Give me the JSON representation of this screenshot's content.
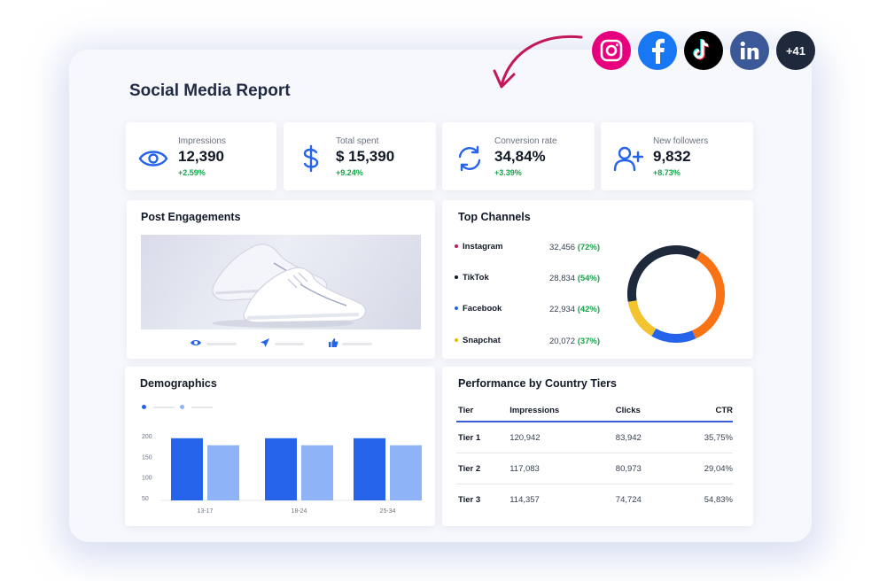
{
  "report": {
    "title": "Social Media Report"
  },
  "social_icons": [
    {
      "name": "instagram-icon",
      "color": "#e1306c"
    },
    {
      "name": "facebook-icon",
      "color": "#1877f2"
    },
    {
      "name": "tiktok-icon",
      "color": "#000000"
    },
    {
      "name": "linkedin-icon",
      "color": "#3b5998"
    }
  ],
  "more_badge": "+41",
  "kpis": [
    {
      "label": "Impressions",
      "value": "12,390",
      "delta": "+2.59%",
      "icon": "eye-icon"
    },
    {
      "label": "Total spent",
      "value": "$ 15,390",
      "delta": "+9.24%",
      "icon": "dollar-icon"
    },
    {
      "label": "Conversion rate",
      "value": "34,84%",
      "delta": "+3.39%",
      "icon": "refresh-icon"
    },
    {
      "label": "New followers",
      "value": "9,832",
      "delta": "+8.73%",
      "icon": "add-user-icon"
    }
  ],
  "post_engagements": {
    "title": "Post Engagements"
  },
  "top_channels": {
    "title": "Top Channels",
    "items": [
      {
        "name": "Instagram",
        "value": "32,456",
        "pct": "(72%)",
        "color": "#e1306c"
      },
      {
        "name": "TikTok",
        "value": "28,834",
        "pct": "(54%)",
        "color": "#111827"
      },
      {
        "name": "Facebook",
        "value": "22,934",
        "pct": "(42%)",
        "color": "#2563eb"
      },
      {
        "name": "Snapchat",
        "value": "20,072",
        "pct": "(37%)",
        "color": "#f4b400"
      }
    ]
  },
  "demographics": {
    "title": "Demographics",
    "chart_data": {
      "type": "bar",
      "categories": [
        "13-17",
        "18-24",
        "25-34"
      ],
      "series": [
        {
          "values": [
            194,
            194,
            194
          ],
          "color": "#2563eb"
        },
        {
          "values": [
            177,
            177,
            177
          ],
          "color": "#8fb3f7"
        }
      ],
      "ylim": [
        50,
        200
      ],
      "yticks": [
        200,
        150,
        100,
        50
      ]
    }
  },
  "country_tiers": {
    "title": "Performance by Country Tiers",
    "columns": [
      "Tier",
      "Impressions",
      "Clicks",
      "CTR"
    ],
    "rows": [
      [
        "Tier 1",
        "120,942",
        "83,942",
        "35,75%"
      ],
      [
        "Tier 2",
        "117,083",
        "80,973",
        "29,04%"
      ],
      [
        "Tier 3",
        "114,357",
        "74,724",
        "54,83%"
      ]
    ]
  },
  "donut": {
    "segments": [
      {
        "pct": 35,
        "color": "#f97316"
      },
      {
        "pct": 15,
        "color": "#2563eb"
      },
      {
        "pct": 14,
        "color": "#f4c430"
      },
      {
        "pct": 36,
        "color": "#1e293b"
      }
    ]
  }
}
